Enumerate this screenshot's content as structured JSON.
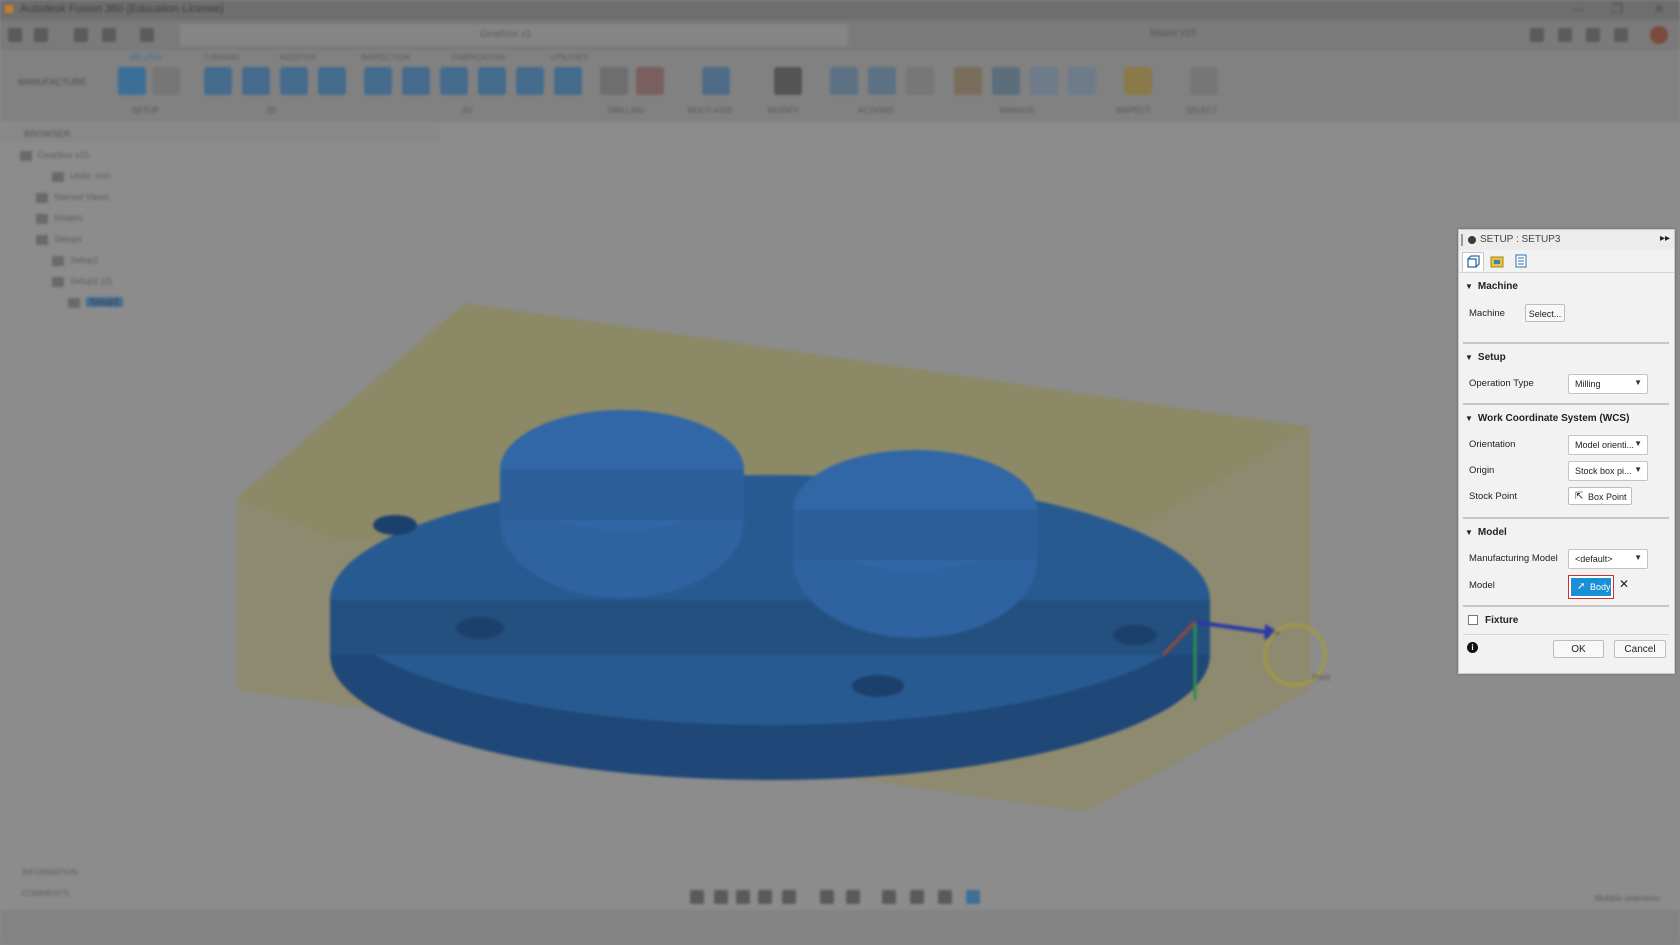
{
  "app": {
    "title": "Autodesk Fusion 360 (Education License)",
    "document_tab": "Gearbox v1",
    "project": "Mazet v15"
  },
  "ribbon": {
    "workspace": "MANUFACTURE",
    "tabs": [
      "MILLING",
      "TURNING",
      "ADDITIVE",
      "INSPECTION",
      "FABRICATION",
      "UTILITIES"
    ],
    "groups": [
      "SETUP",
      "2D",
      "3D",
      "DRILLING",
      "MULTI-AXIS",
      "MODIFY",
      "ACTIONS",
      "MANAGE",
      "INSPECT",
      "SELECT"
    ]
  },
  "browser": {
    "header": "BROWSER",
    "items": [
      {
        "label": "Gearbox v15",
        "indent": 0
      },
      {
        "label": "Units: mm",
        "indent": 1
      },
      {
        "label": "Named Views",
        "indent": 1
      },
      {
        "label": "Models",
        "indent": 1
      },
      {
        "label": "Setups",
        "indent": 1
      },
      {
        "label": "Setup1",
        "indent": 2
      },
      {
        "label": "Setup1 (2)",
        "indent": 2
      },
      {
        "label": "Setup3",
        "indent": 2,
        "selected": true
      }
    ]
  },
  "bottom_panels": {
    "info": "INFORMATION",
    "comments": "COMMENTS"
  },
  "status": {
    "right": "Multiple selections"
  },
  "dialog": {
    "title": "SETUP : SETUP3",
    "sections": {
      "machine": {
        "header": "Machine",
        "machine_label": "Machine",
        "machine_button": "Select..."
      },
      "setup": {
        "header": "Setup",
        "operation_type_label": "Operation Type",
        "operation_type_value": "Milling"
      },
      "wcs": {
        "header": "Work Coordinate System (WCS)",
        "orientation_label": "Orientation",
        "orientation_value": "Model orienti...",
        "origin_label": "Origin",
        "origin_value": "Stock box pi...",
        "stock_point_label": "Stock Point",
        "stock_point_button": "Box Point"
      },
      "model": {
        "header": "Model",
        "manufacturing_model_label": "Manufacturing Model",
        "manufacturing_model_value": "<default>",
        "model_label": "Model",
        "model_button": "Body"
      },
      "fixture": {
        "label": "Fixture",
        "checked": false
      }
    },
    "ok_label": "OK",
    "cancel_label": "Cancel"
  },
  "viewport": {
    "point_tooltip": "Point"
  }
}
